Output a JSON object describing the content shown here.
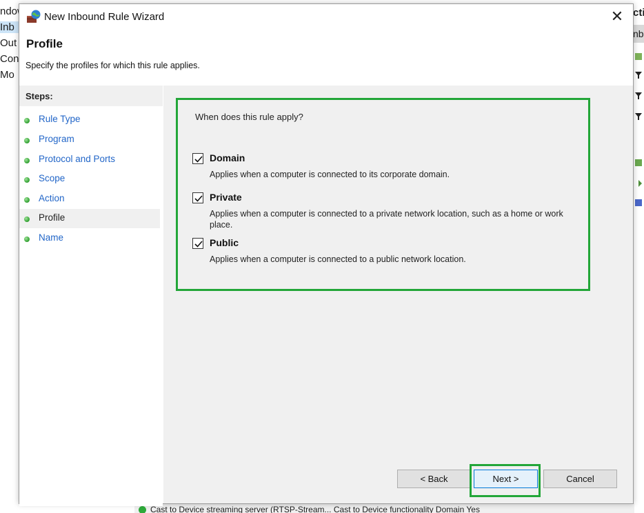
{
  "background": {
    "left_items": [
      "ndow",
      "Inb",
      "Out",
      "Con",
      "Mo"
    ],
    "right_header": "cti",
    "right_bar": "nb",
    "status_text": "Cast to Device streaming server (RTSP-Stream...  Cast to Device functionality    Domain    Yes"
  },
  "dialog": {
    "title": "New Inbound Rule Wizard",
    "close_glyph": "✕",
    "header": {
      "title": "Profile",
      "description": "Specify the profiles for which this rule applies."
    },
    "steps": {
      "title": "Steps:",
      "items": [
        {
          "label": "Rule Type"
        },
        {
          "label": "Program"
        },
        {
          "label": "Protocol and Ports"
        },
        {
          "label": "Scope"
        },
        {
          "label": "Action"
        },
        {
          "label": "Profile",
          "active": true
        },
        {
          "label": "Name"
        }
      ]
    },
    "main": {
      "question": "When does this rule apply?",
      "options": [
        {
          "label": "Domain",
          "checked": true,
          "description": "Applies when a computer is connected to its corporate domain."
        },
        {
          "label": "Private",
          "checked": true,
          "description": "Applies when a computer is connected to a private network location, such as a home or work place."
        },
        {
          "label": "Public",
          "checked": true,
          "description": "Applies when a computer is connected to a public network location."
        }
      ]
    },
    "buttons": {
      "back": "< Back",
      "next": "Next >",
      "cancel": "Cancel"
    }
  },
  "colors": {
    "highlight": "#22a638",
    "link": "#2266c8",
    "panel": "#f0f0f0"
  }
}
